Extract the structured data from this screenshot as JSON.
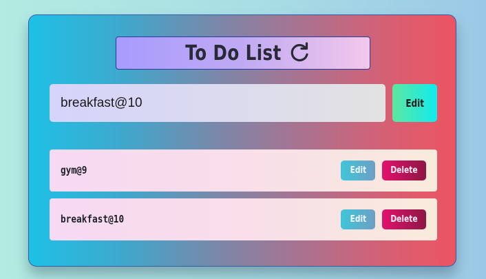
{
  "app": {
    "title": "To Do List",
    "refresh_icon": "refresh-icon"
  },
  "input": {
    "value": "breakfast@10",
    "placeholder": ""
  },
  "main_button": {
    "label": "Edit"
  },
  "todos": [
    {
      "text": "gym@9",
      "edit_label": "Edit",
      "delete_label": "Delete"
    },
    {
      "text": "breakfast@10",
      "edit_label": "Edit",
      "delete_label": "Delete"
    }
  ],
  "colors": {
    "card_start": "#1fc0e6",
    "card_end": "#ed5462",
    "edit_button": "#10ebee",
    "delete_button": "#e2116e",
    "item_edit_button": "#3fc6d8"
  }
}
